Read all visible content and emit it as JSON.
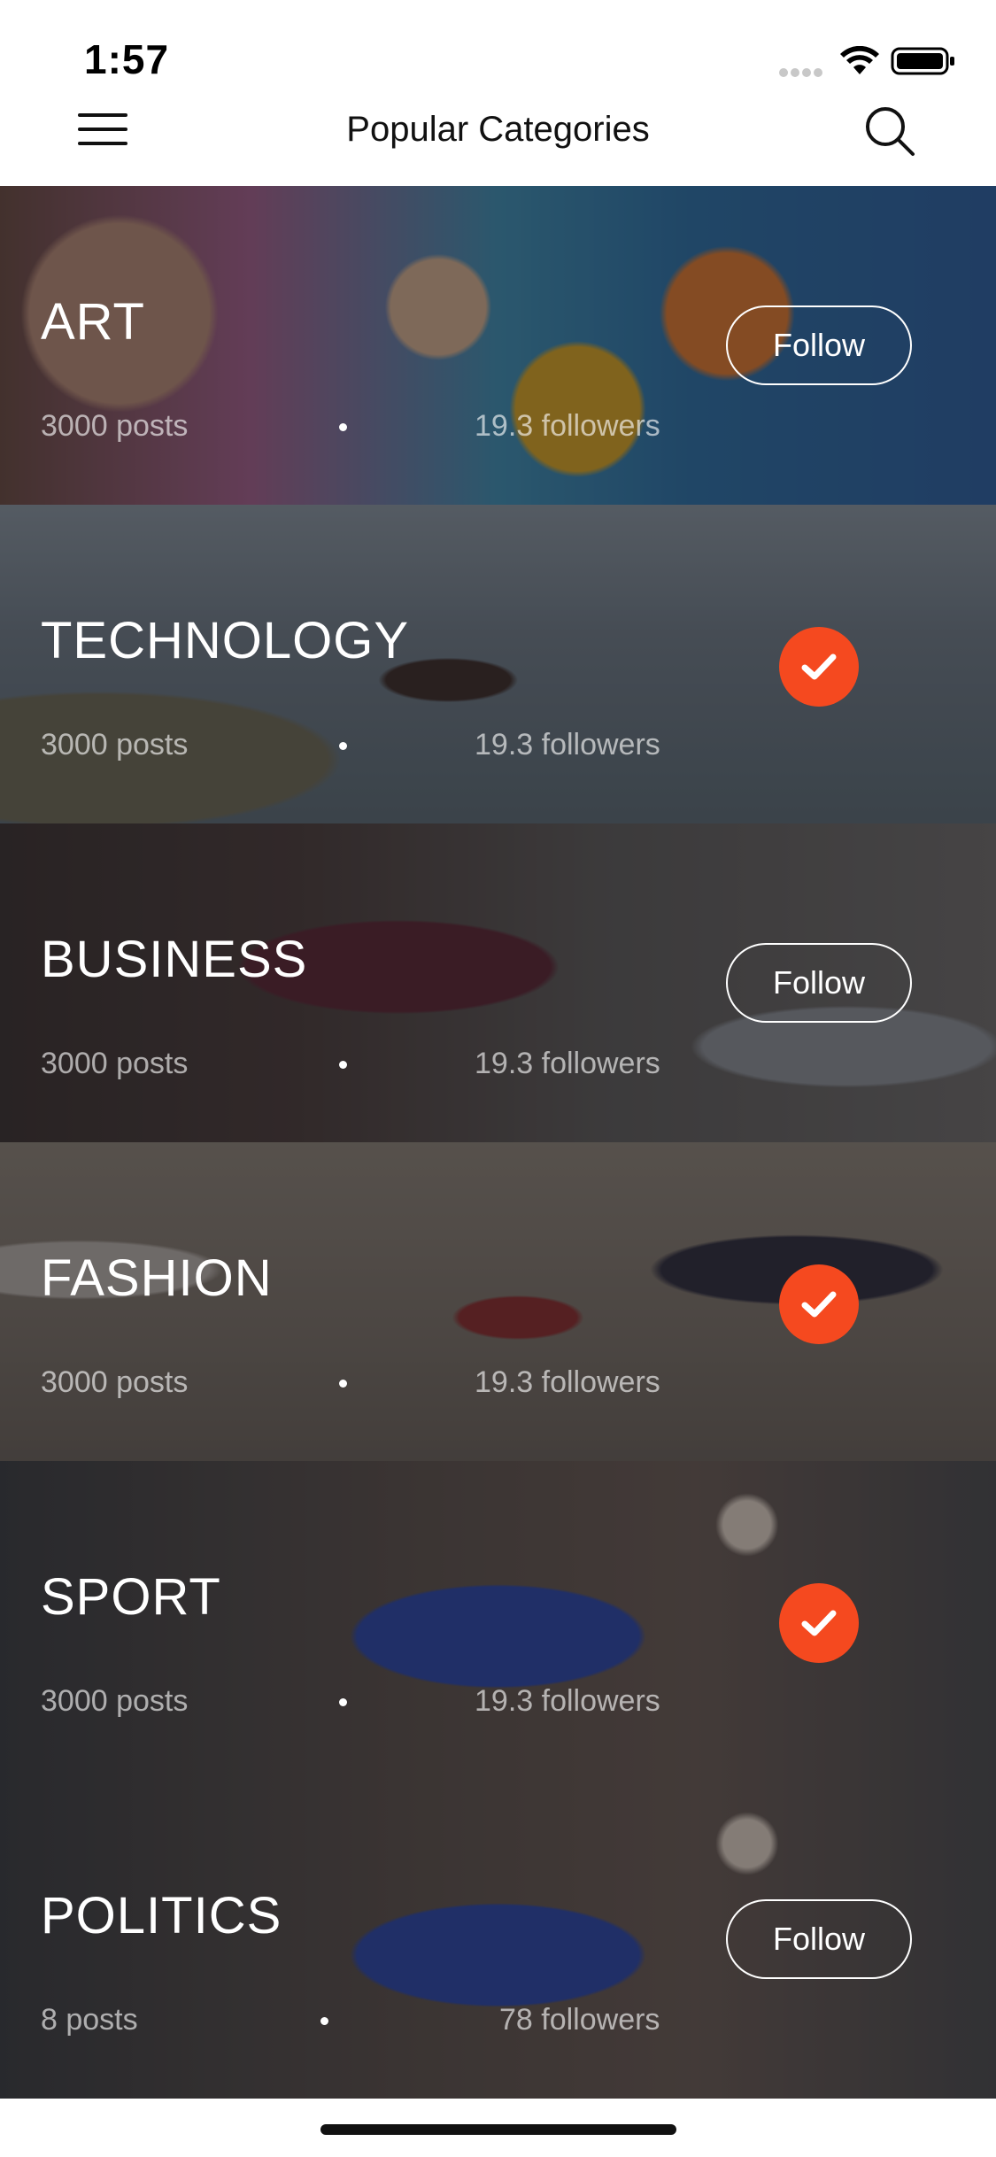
{
  "status_bar": {
    "time": "1:57"
  },
  "nav": {
    "title": "Popular Categories",
    "menu_icon": "hamburger-menu-icon",
    "search_icon": "search-icon"
  },
  "categories": [
    {
      "title": "ART",
      "posts": "3000 posts",
      "followers": "19.3 followers",
      "followed": false,
      "follow_label": "Follow"
    },
    {
      "title": "TECHNOLOGY",
      "posts": "3000 posts",
      "followers": "19.3 followers",
      "followed": true
    },
    {
      "title": "BUSINESS",
      "posts": "3000 posts",
      "followers": "19.3 followers",
      "followed": false,
      "follow_label": "Follow"
    },
    {
      "title": "FASHION",
      "posts": "3000 posts",
      "followers": "19.3 followers",
      "followed": true
    },
    {
      "title": "SPORT",
      "posts": "3000 posts",
      "followers": "19.3 followers",
      "followed": true
    },
    {
      "title": "POLITICS",
      "posts": "8 posts",
      "followers": "78 followers",
      "followed": false,
      "follow_label": "Follow"
    }
  ],
  "colors": {
    "accent": "#f5491f",
    "text_on_image": "#ffffff"
  }
}
